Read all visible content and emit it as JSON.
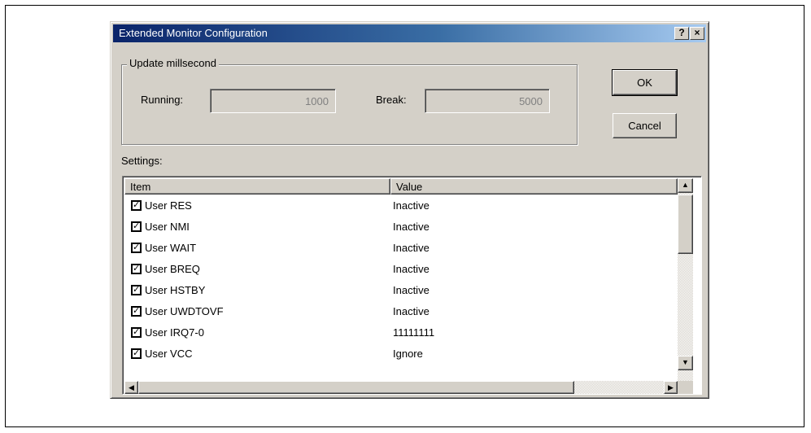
{
  "dialog": {
    "title": "Extended Monitor Configuration",
    "help_label": "?",
    "close_label": "×"
  },
  "update_group": {
    "legend": "Update millsecond",
    "running_label": "Running:",
    "running_value": "1000",
    "break_label": "Break:",
    "break_value": "5000"
  },
  "buttons": {
    "ok": "OK",
    "cancel": "Cancel"
  },
  "settings": {
    "label": "Settings:",
    "columns": [
      "Item",
      "Value"
    ],
    "rows": [
      {
        "item": "User RES",
        "value": "Inactive",
        "checked": true
      },
      {
        "item": "User NMI",
        "value": "Inactive",
        "checked": true
      },
      {
        "item": "User WAIT",
        "value": "Inactive",
        "checked": true
      },
      {
        "item": "User BREQ",
        "value": "Inactive",
        "checked": true
      },
      {
        "item": "User HSTBY",
        "value": "Inactive",
        "checked": true
      },
      {
        "item": "User UWDTOVF",
        "value": "Inactive",
        "checked": true
      },
      {
        "item": "User IRQ7-0",
        "value": "11111111",
        "checked": true
      },
      {
        "item": "User VCC",
        "value": "Ignore",
        "checked": true
      }
    ]
  },
  "icons": {
    "scroll_up": "triangle-up",
    "scroll_down": "triangle-down",
    "scroll_left": "triangle-left",
    "scroll_right": "triangle-right",
    "checkbox": "check-mark"
  },
  "colors": {
    "titlebar_start": "#0a246a",
    "titlebar_end": "#a6caf0",
    "face": "#d4d0c8"
  }
}
